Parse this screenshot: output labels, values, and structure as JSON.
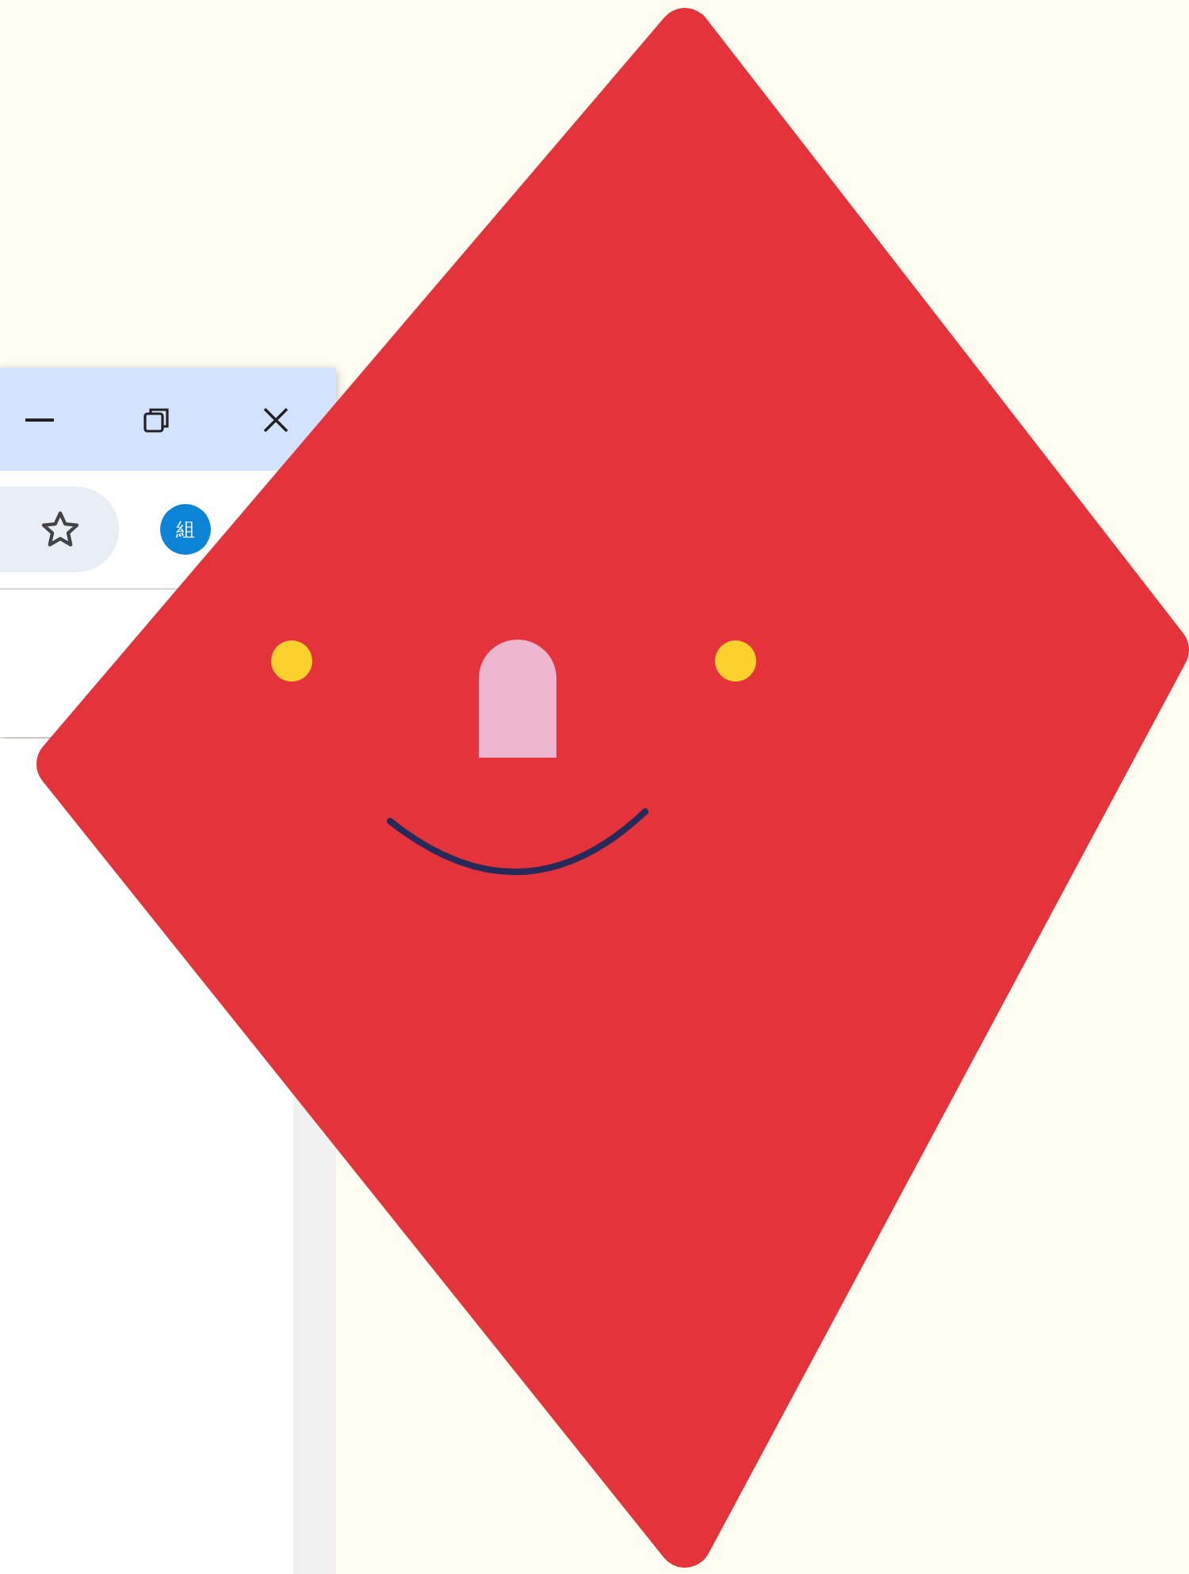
{
  "browser": {
    "profile_avatar": {
      "label": "組"
    }
  }
}
